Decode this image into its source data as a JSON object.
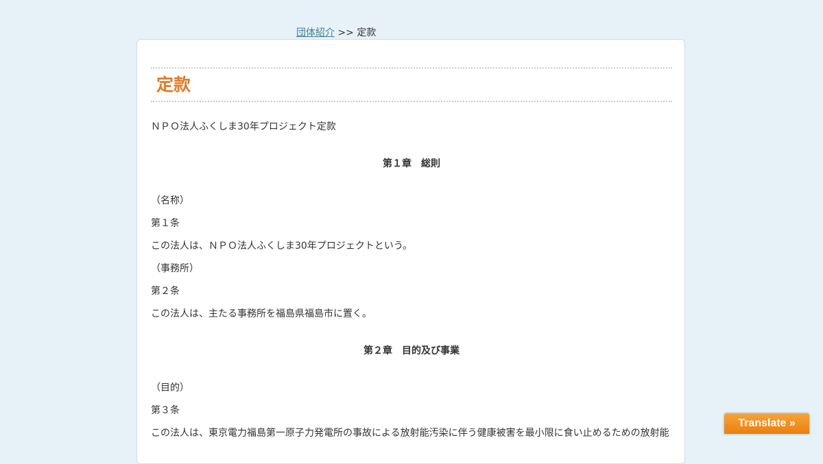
{
  "breadcrumb": {
    "link": "団体紹介",
    "separator": " >> ",
    "current": "定款"
  },
  "page": {
    "title": "定款"
  },
  "content": {
    "doc_title": "ＮＰＯ法人ふくしま30年プロジェクト定款",
    "chapter1": "第１章　総則",
    "art1_caption": "（名称）",
    "art1_label": "第１条",
    "art1_text": "この法人は、ＮＰＯ法人ふくしま30年プロジェクトという。",
    "art2_caption": "（事務所）",
    "art2_label": "第２条",
    "art2_text": "この法人は、主たる事務所を福島県福島市に置く。",
    "chapter2": "第２章　目的及び事業",
    "art3_caption": "（目的）",
    "art3_label": "第３条",
    "art3_text": "この法人は、東京電力福島第一原子力発電所の事故による放射能汚染に伴う健康被害を最小限に食い止めるための放射能"
  },
  "translate": {
    "label": "Translate »"
  },
  "colors": {
    "background": "#e7f2f8",
    "title": "#e07b2a",
    "link": "#3f7f8f",
    "translate_button": "#f39a2e"
  }
}
